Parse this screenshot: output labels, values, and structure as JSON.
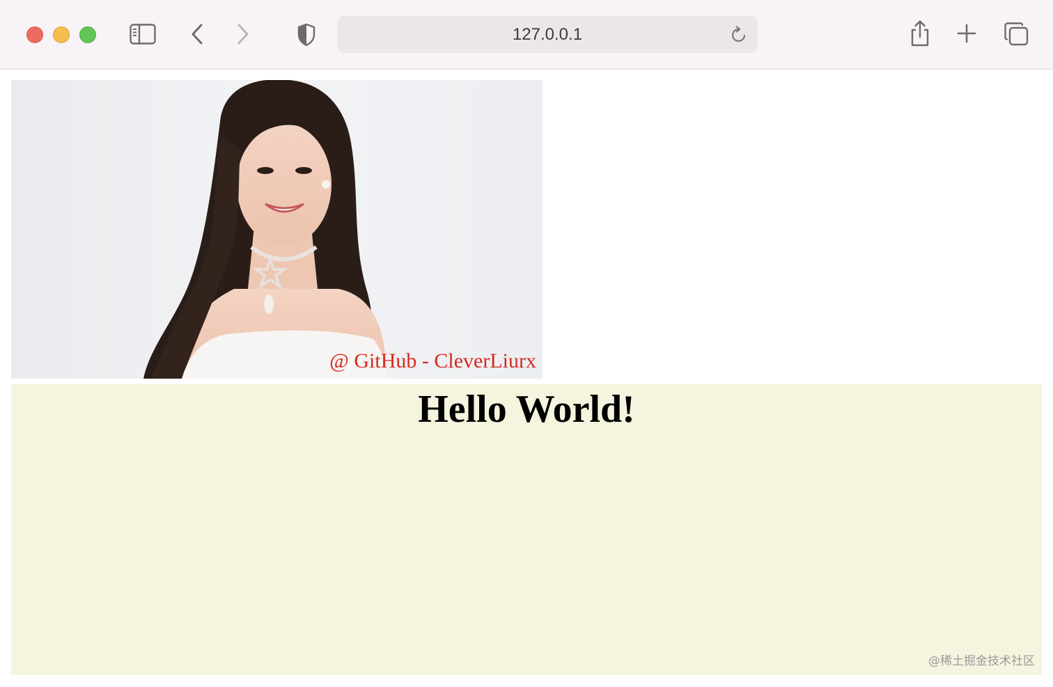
{
  "browser": {
    "url": "127.0.0.1",
    "icons": {
      "sidebar": "sidebar-icon",
      "back": "chevron-left-icon",
      "forward": "chevron-right-icon",
      "privacy": "shield-icon",
      "reload": "reload-icon",
      "share": "share-icon",
      "new_tab": "plus-icon",
      "tabs": "tab-overview-icon"
    },
    "colors": {
      "close": "#ec6a5e",
      "minimize": "#f4bf4f",
      "zoom": "#61c554"
    }
  },
  "page": {
    "image_caption": "@ GitHub - CleverLiurx",
    "heading": "Hello World!",
    "box_color": "#f5f5df",
    "site_watermark": "@稀土掘金技术社区"
  }
}
